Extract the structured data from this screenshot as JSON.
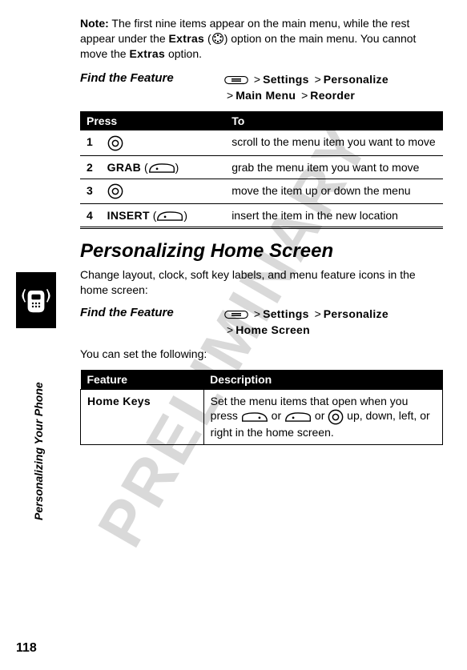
{
  "watermark": "PRELIMINARY",
  "side_label": "Personalizing Your Phone",
  "page_number": "118",
  "note": {
    "label": "Note:",
    "text_parts": {
      "a": "The first nine items appear on the main menu, while the rest appear under the ",
      "b": "Extras",
      "c": " (",
      "d": ") option on the main menu. You cannot move the ",
      "e": "Extras",
      "f": " option."
    }
  },
  "find1": {
    "label": "Find the Feature",
    "path": [
      "Settings",
      "Personalize",
      "Main Menu",
      "Reorder"
    ]
  },
  "steps_table": {
    "head": {
      "press": "Press",
      "to": "To"
    },
    "rows": [
      {
        "n": "1",
        "press_label": "",
        "press_icon": "nav",
        "to": "scroll to the menu item you want to move"
      },
      {
        "n": "2",
        "press_label": "GRAB",
        "press_icon": "softkey",
        "to": "grab the menu item you want to move"
      },
      {
        "n": "3",
        "press_label": "",
        "press_icon": "nav",
        "to": "move the item up or down the menu"
      },
      {
        "n": "4",
        "press_label": "INSERT",
        "press_icon": "softkey",
        "to": "insert the item in the new location"
      }
    ]
  },
  "section_heading": "Personalizing Home Screen",
  "section_intro": "Change layout, clock, soft key labels, and menu feature icons in the home screen:",
  "find2": {
    "label": "Find the Feature",
    "path": [
      "Settings",
      "Personalize",
      "Home Screen"
    ]
  },
  "set_following": "You can set the following:",
  "feat_table": {
    "head": {
      "feature": "Feature",
      "description": "Description"
    },
    "row1": {
      "feature": "Home Keys",
      "desc_a": "Set the menu items that open when you press ",
      "desc_b": " or ",
      "desc_c": " or ",
      "desc_d": " up, down, left, or right in the home screen."
    }
  }
}
